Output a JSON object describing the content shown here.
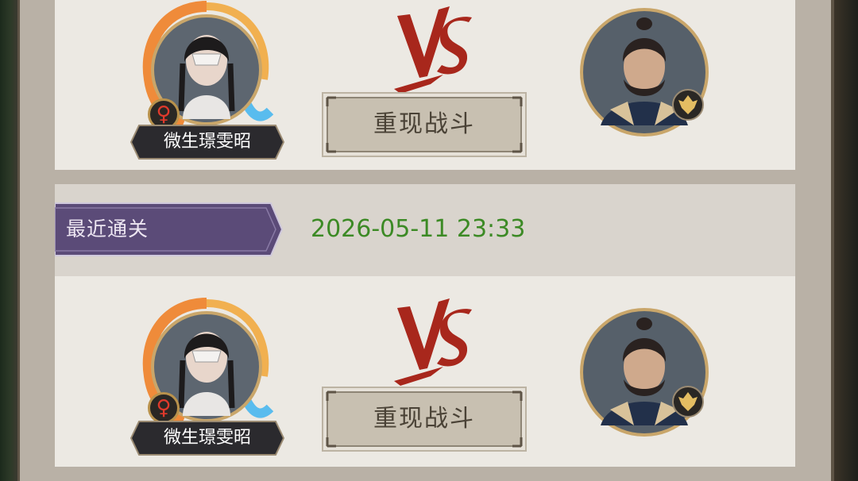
{
  "colors": {
    "panel": "#b9b1a6",
    "card": "#ece9e3",
    "record_label_bg": "#5b4b78",
    "record_time": "#3c8a25",
    "vs_red": "#a8271c",
    "button_face": "#c8c0b1",
    "name_plate": "#2b2a2e"
  },
  "battles": [
    {
      "player_name": "微生璟雯昭",
      "gender_symbol": "♀",
      "vs_icon": "vs-icon",
      "replay_label": "重现战斗",
      "opponent_badge_icon": "rank-badge-icon"
    },
    {
      "player_name": "微生璟雯昭",
      "gender_symbol": "♀",
      "vs_icon": "vs-icon",
      "replay_label": "重现战斗",
      "opponent_badge_icon": "rank-badge-icon"
    }
  ],
  "latest_clear": {
    "label": "最近通关",
    "time": "2026-05-11 23:33"
  }
}
